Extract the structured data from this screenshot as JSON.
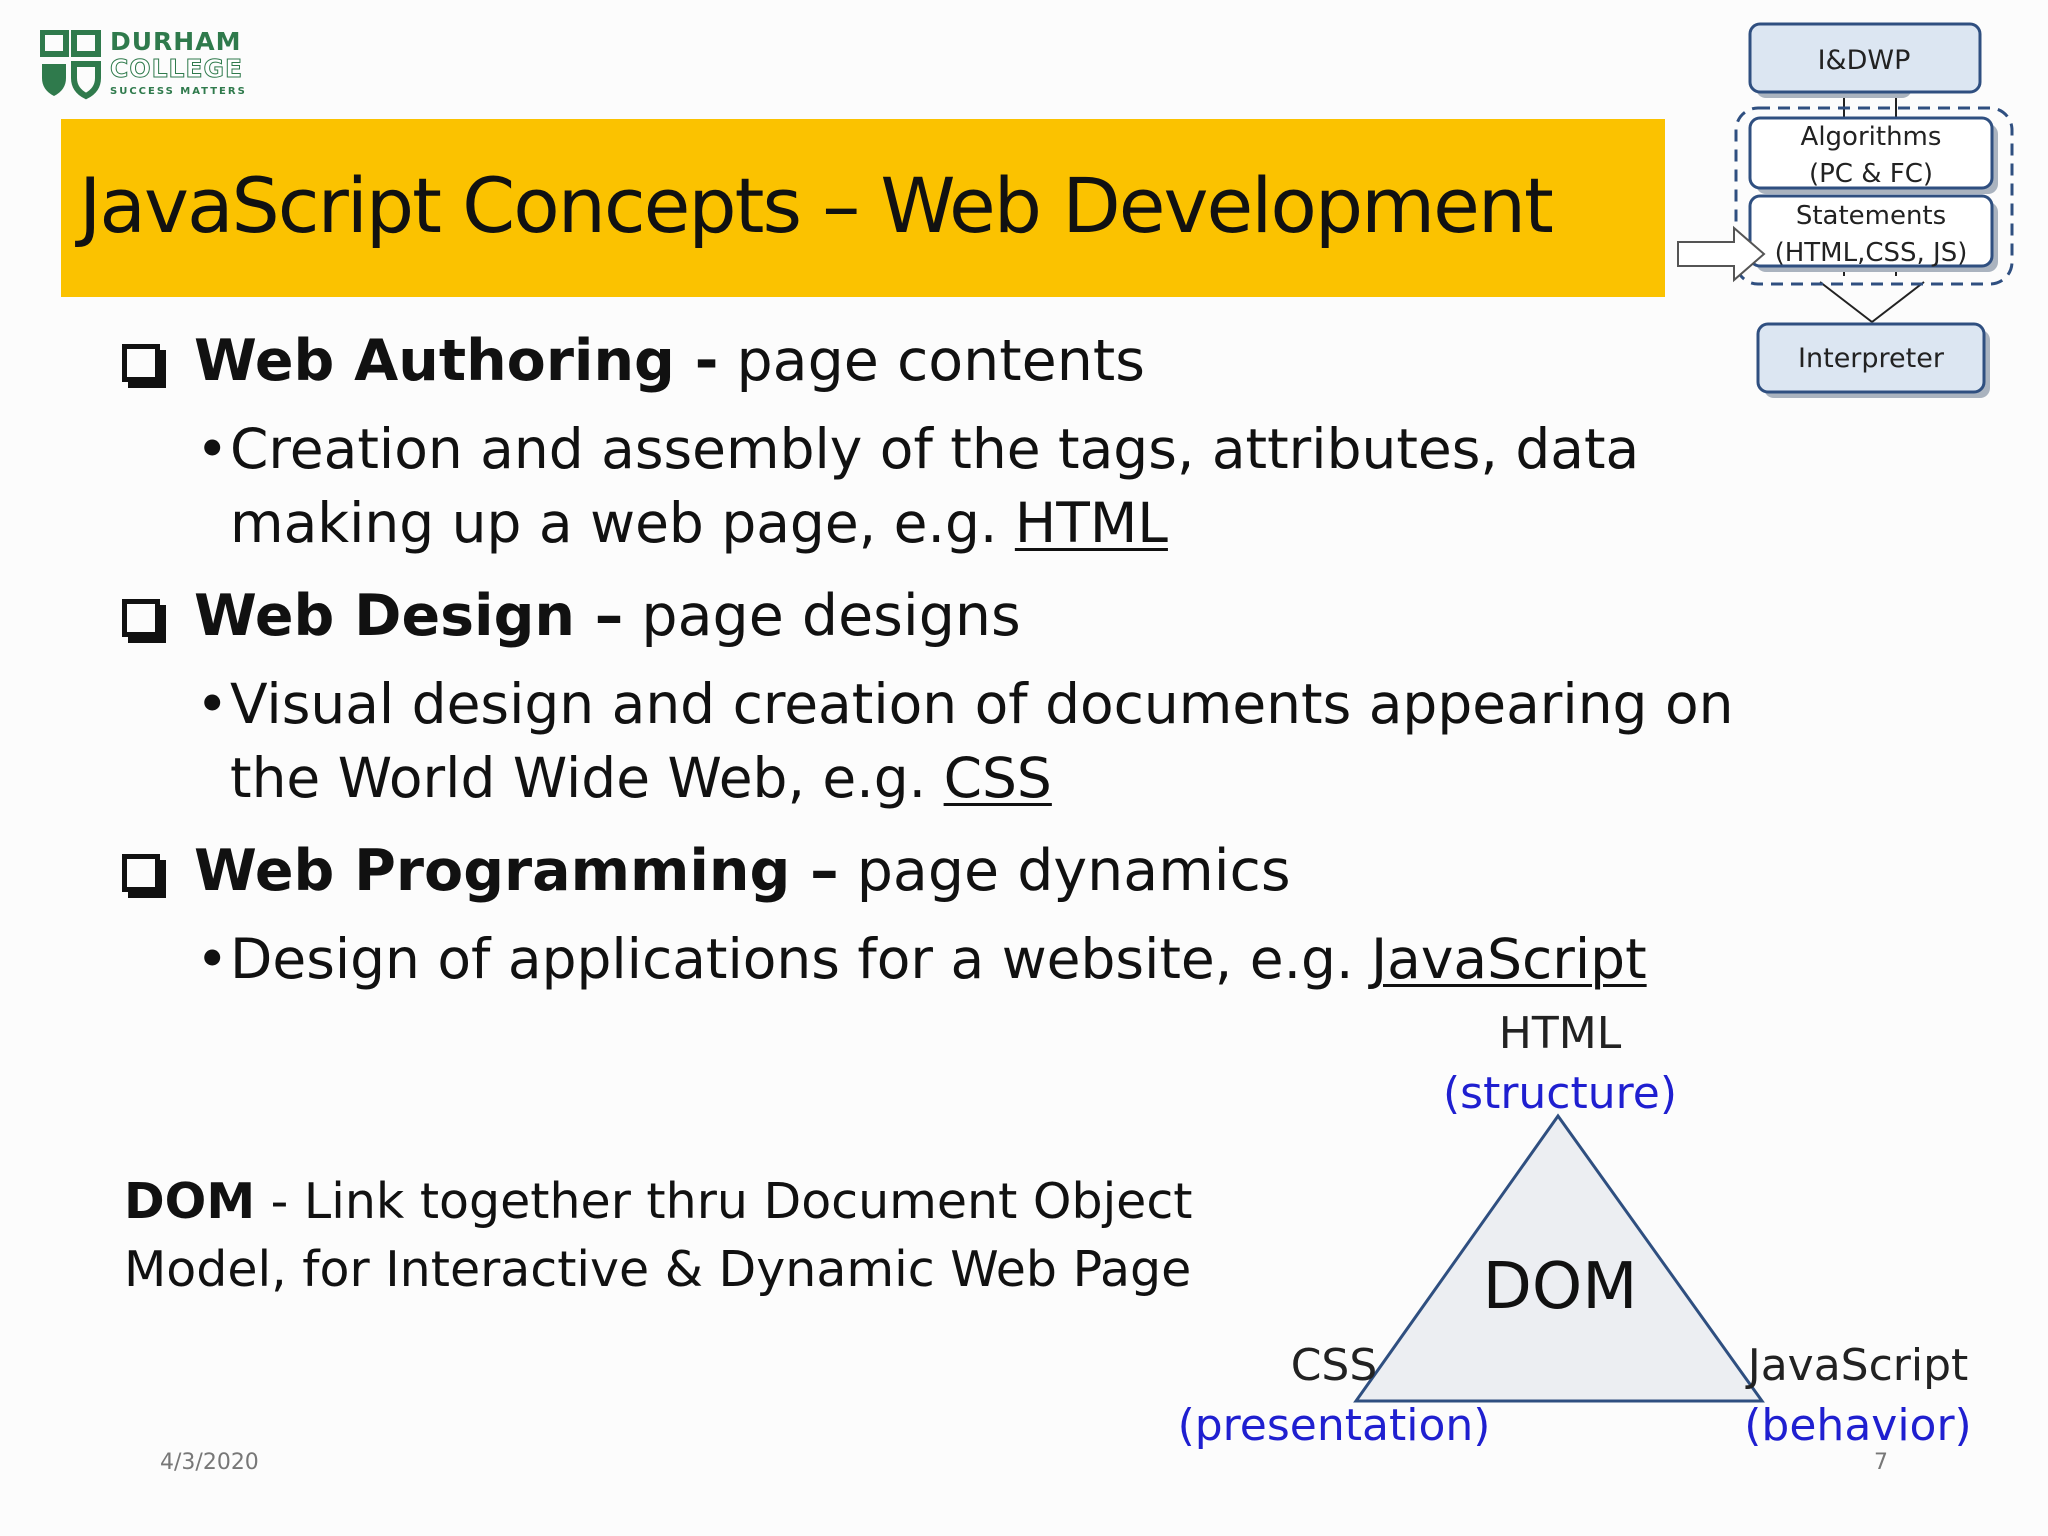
{
  "logo": {
    "line1": "DURHAM",
    "line2": "COLLEGE",
    "line3": "SUCCESS MATTERS"
  },
  "title": "JavaScript Concepts – Web Development",
  "items": [
    {
      "head_bold": "Web Authoring -",
      "head_rest": " page contents",
      "sub_line1": "Creation and assembly of the tags, attributes, data",
      "sub_line2_prefix": "making up a web page, e.g. ",
      "sub_link": "HTML"
    },
    {
      "head_bold": "Web Design –",
      "head_rest": " page designs",
      "sub_line1": "Visual design and creation of documents appearing on",
      "sub_line2_prefix": "the World Wide Web, e.g. ",
      "sub_link": "CSS"
    },
    {
      "head_bold": "Web Programming –",
      "head_rest": " page dynamics",
      "sub_line1_prefix": "Design of applications for a website, e.g. ",
      "sub_link": "JavaScript"
    }
  ],
  "dom_text": {
    "bold": "DOM",
    "line1_rest": " - Link together thru Document Object",
    "line2": "Model, for Interactive & Dynamic Web Page"
  },
  "triangle": {
    "center": "DOM",
    "top_label": "HTML",
    "top_sub": "(structure)",
    "left_label": "CSS",
    "left_sub": "(presentation)",
    "right_label": "JavaScript",
    "right_sub": "(behavior)"
  },
  "flow": {
    "box1": "I&DWP",
    "box2_line1": "Algorithms",
    "box2_line2": "(PC & FC)",
    "box3_line1": "Statements",
    "box3_line2": "(HTML,CSS, JS)",
    "box4": "Interpreter"
  },
  "footer": {
    "date": "4/3/2020",
    "page": "7"
  },
  "colors": {
    "title_bar": "#fbc200",
    "logo_green": "#2f7a4c",
    "label_blue": "#1f1fd0",
    "flow_box": "#dce6f2",
    "flow_border": "#2f4f80"
  }
}
